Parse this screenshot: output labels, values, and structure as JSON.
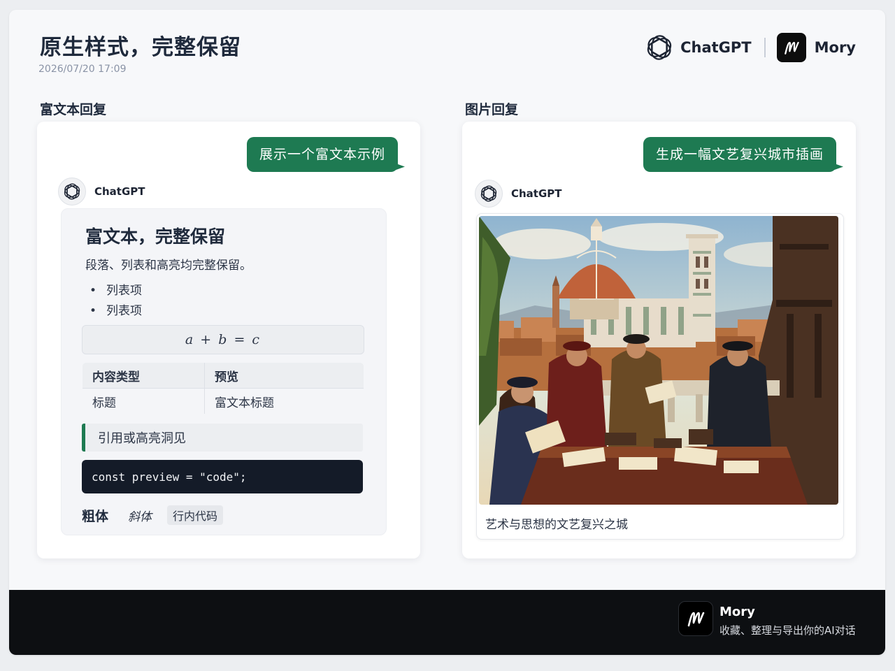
{
  "header": {
    "title": "原生样式，完整保留",
    "timestamp": "2026/07/20 17:09",
    "brand_chatgpt": "ChatGPT",
    "brand_mory": "Mory"
  },
  "left": {
    "section_label": "富文本回复",
    "user_message": "展示一个富文本示例",
    "assistant_name": "ChatGPT",
    "rich": {
      "title": "富文本，完整保留",
      "paragraph": "段落、列表和高亮均完整保留。",
      "list_items": [
        "列表项",
        "列表项"
      ],
      "math": "a + b = c",
      "table": {
        "headers": [
          "内容类型",
          "预览"
        ],
        "row": [
          "标题",
          "富文本标题"
        ]
      },
      "quote": "引用或高亮洞见",
      "code": "const preview = \"code\";",
      "bold": "粗体",
      "italic": "斜体",
      "inline_code": "行内代码"
    }
  },
  "right": {
    "section_label": "图片回复",
    "user_message": "生成一幅文艺复兴城市插画",
    "assistant_name": "ChatGPT",
    "image_caption": "艺术与思想的文艺复兴之城"
  },
  "footer": {
    "name": "Mory",
    "tagline": "收藏、整理与导出你的AI对话"
  },
  "colors": {
    "accent": "#1e7a52",
    "footer_bg": "#0d0f12",
    "code_bg": "#141b28"
  },
  "icons": {
    "chatgpt": "openai-knot-icon",
    "mory": "mory-m-icon"
  }
}
